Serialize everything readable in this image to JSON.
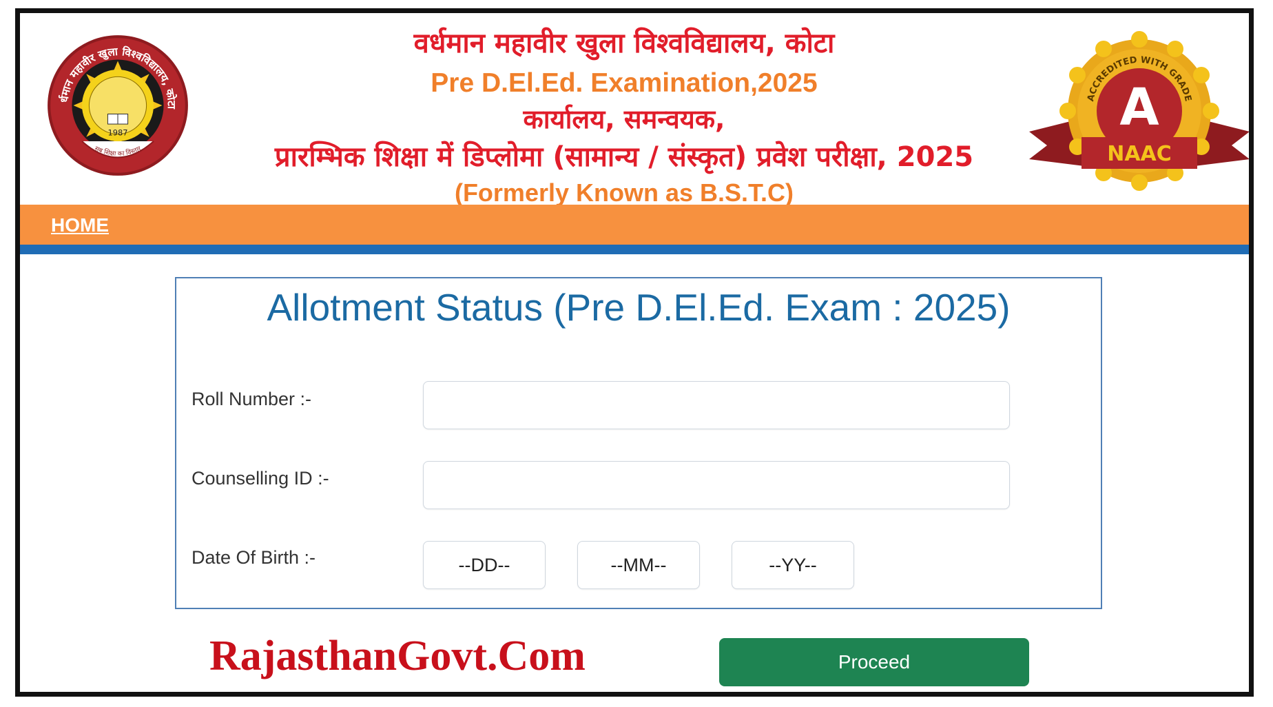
{
  "header": {
    "line1": "वर्धमान महावीर खुला विश्वविद्यालय, कोटा",
    "line2": "Pre D.El.Ed. Examination,2025",
    "line3": "कार्यालय, समन्वयक,",
    "line4": "प्रारम्भिक शिक्षा में डिप्लोमा (सामान्य / संस्कृत) प्रवेश परीक्षा, 2025",
    "line5": "(Formerly Known as B.S.T.C)",
    "left_logo": {
      "arc_text": "वर्धमान महावीर खुला विश्वविद्यालय, कोटा",
      "year": "1987",
      "motto": "सब शिक्षा का विस्तार"
    },
    "right_badge": {
      "arc_text": "ACCREDITED WITH GRADE",
      "grade": "A",
      "ribbon": "NAAC"
    }
  },
  "nav": {
    "home_label": "HOME"
  },
  "form": {
    "title": "Allotment Status (Pre D.El.Ed. Exam : 2025)",
    "roll_label": "Roll Number :-",
    "roll_value": "",
    "counselling_label": "Counselling ID :-",
    "counselling_value": "",
    "dob_label": "Date Of Birth :-",
    "dob_day": "--DD--",
    "dob_month": "--MM--",
    "dob_year": "--YY--"
  },
  "watermark": "RajasthanGovt.Com",
  "proceed_label": "Proceed",
  "colors": {
    "header_red": "#e11d2a",
    "header_orange": "#f07f2a",
    "nav_orange": "#f7913f",
    "nav_blue": "#1f6cb5",
    "title_blue": "#1b6aa3",
    "proceed_green": "#1e8452",
    "watermark_red": "#c8101b"
  }
}
